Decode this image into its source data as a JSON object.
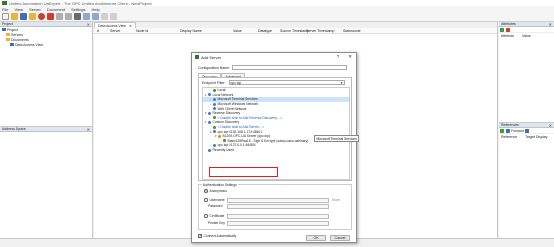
{
  "window": {
    "title": "Unified Automation UaExpert - The OPC Unified Architecture Client - NewProject"
  },
  "menu": [
    "File",
    "View",
    "Server",
    "Document",
    "Settings",
    "Help"
  ],
  "project_panel": {
    "title": "Project",
    "tree": [
      "Project",
      "Servers",
      "Documents",
      "Data Access View"
    ]
  },
  "address_panel": {
    "title": "Address Space"
  },
  "data_access": {
    "tab": "Data Access View",
    "columns": [
      "#",
      "Server",
      "Node Id",
      "Display Name",
      "Value",
      "Datatype",
      "Source Timestamp",
      "Server Timestamp",
      "Statuscode"
    ]
  },
  "attributes_panel": {
    "title": "Attributes",
    "columns": [
      "Attribute",
      "Value"
    ]
  },
  "references_panel": {
    "title": "References",
    "forward_label": "Forward",
    "columns": [
      "Reference",
      "Target Display"
    ]
  },
  "dialog": {
    "title": "Add Server",
    "help": "?",
    "close": "✕",
    "config_name_label": "Configuration Name",
    "tabs": [
      "Discovery",
      "Advanced"
    ],
    "endpoint_filter_label": "Endpoint Filter:",
    "endpoint_filter_value": "opc.tcp",
    "tree": [
      {
        "label": "Local",
        "indent": 1,
        "color": "#4a8f2a"
      },
      {
        "label": "Local Network",
        "indent": 0,
        "color": "#3f7fc6",
        "expander": "▾"
      },
      {
        "label": "Microsoft Terminal Services",
        "indent": 1,
        "color": "#3f7fc6",
        "selected": true,
        "expander": "›"
      },
      {
        "label": "Microsoft Windows Network",
        "indent": 1,
        "color": "#3f7fc6",
        "expander": "›"
      },
      {
        "label": "Web Client Network",
        "indent": 1,
        "color": "#3f7fc6"
      },
      {
        "label": "Reverse Discovery",
        "indent": 0,
        "color": "#3f7fc6",
        "expander": "▾"
      },
      {
        "label": "< Double click to Add Reverse Discovery... >",
        "indent": 1,
        "color": "#4a8f2a",
        "link": true
      },
      {
        "label": "Custom Discovery",
        "indent": 0,
        "color": "#3f7fc6",
        "expander": "▾"
      },
      {
        "label": "< Double click to Add Server... >",
        "indent": 1,
        "color": "#4a8f2a",
        "link": true
      },
      {
        "label": "opc.tcp://192.168.1.173:48401",
        "indent": 1,
        "color": "#3f7fc6",
        "expander": "▾"
      },
      {
        "label": "BL209-OPC-UA Server (opc.tcp)",
        "indent": 2,
        "color": "#c8a000",
        "expander": "▾"
      },
      {
        "label": "Basic128Rsa15 - Sign & Encrypt (uatcp-uasc-uabinary)",
        "indent": 3,
        "color": "#4a8f2a"
      },
      {
        "label": "opc.tcp://127.0.0.1:48480/",
        "indent": 1,
        "color": "#3f7fc6",
        "expander": "›"
      },
      {
        "label": "Recently Used",
        "indent": 0,
        "color": "#3f7fc6"
      }
    ],
    "tooltip": "Microsoft Terminal Services",
    "auth": {
      "legend": "Authentication Settings",
      "anonymous": "Anonymous",
      "username": "Username",
      "password": "Password",
      "store": "Store",
      "certificate": "Certificate",
      "private_key": "Private Key"
    },
    "connect_auto": "Connect Automatically",
    "ok": "OK",
    "cancel": "Cancel"
  }
}
